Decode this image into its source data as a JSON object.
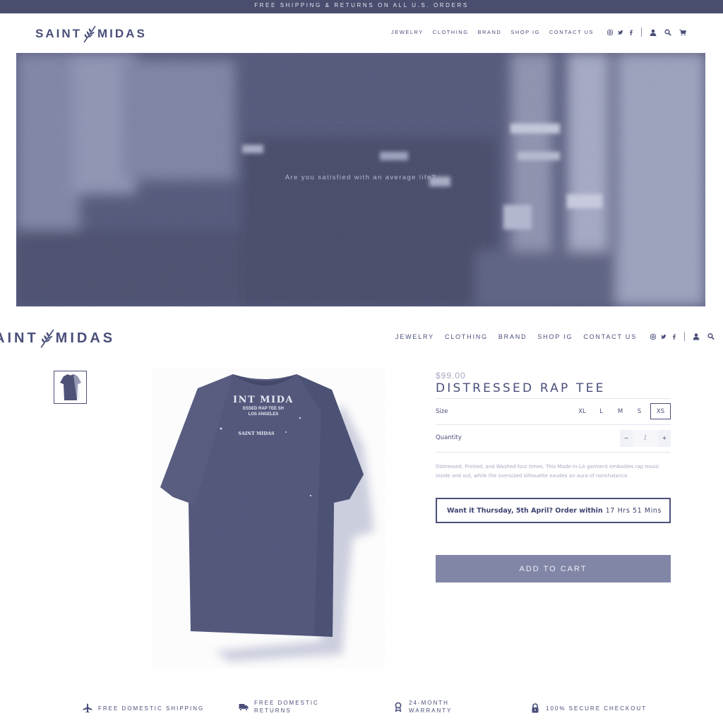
{
  "announcement": "FREE SHIPPING & RETURNS ON ALL U.S. ORDERS",
  "brand": {
    "left": "SAINT",
    "right": "MIDAS",
    "left_cut": "AINT"
  },
  "nav": [
    "JEWELRY",
    "CLOTHING",
    "BRAND",
    "SHOP IG",
    "CONTACT US"
  ],
  "icons": {
    "social": [
      "instagram-icon",
      "twitter-icon",
      "facebook-icon"
    ],
    "util": [
      "account-icon",
      "search-icon",
      "cart-icon"
    ]
  },
  "hero": {
    "tagline": "Are you satisfied with an average life?"
  },
  "product": {
    "price": "$99.00",
    "title": "DISTRESSED RAP TEE",
    "size_label": "Size",
    "sizes": [
      "XL",
      "L",
      "M",
      "S",
      "XS"
    ],
    "selected_size": "XS",
    "quantity_label": "Quantity",
    "quantity": "1",
    "minus": "−",
    "plus": "+",
    "description": "Distressed, Printed, and Washed four times. This Made-in-LA garment embodies rap music inside and out, while the oversized silhouette exudes an aura of nonchalance.",
    "delivery_prompt": "Want it Thursday, 5th April?  Order within",
    "delivery_countdown": "17 Hrs 51 Mins",
    "add_to_cart": "ADD TO CART",
    "shirt_print": {
      "line1": "INT MIDA",
      "line2": "ESSED RAP TEE SH",
      "line3": "LOS ANGELES",
      "chest": "SAINT MIDAS"
    }
  },
  "perks": [
    {
      "icon": "airplane-icon",
      "line1": "FREE DOMESTIC SHIPPING",
      "line2": ""
    },
    {
      "icon": "truck-icon",
      "line1": "FREE DOMESTIC",
      "line2": "RETURNS"
    },
    {
      "icon": "ribbon-icon",
      "line1": "24-MONTH",
      "line2": "WARRANTY"
    },
    {
      "icon": "lock-icon",
      "line1": "100% SECURE CHECKOUT",
      "line2": ""
    }
  ],
  "colors": {
    "accent": "#4a4f7a",
    "muted": "#a4a8c2",
    "button": "#8186a6",
    "banner": "#4a4e6e"
  }
}
